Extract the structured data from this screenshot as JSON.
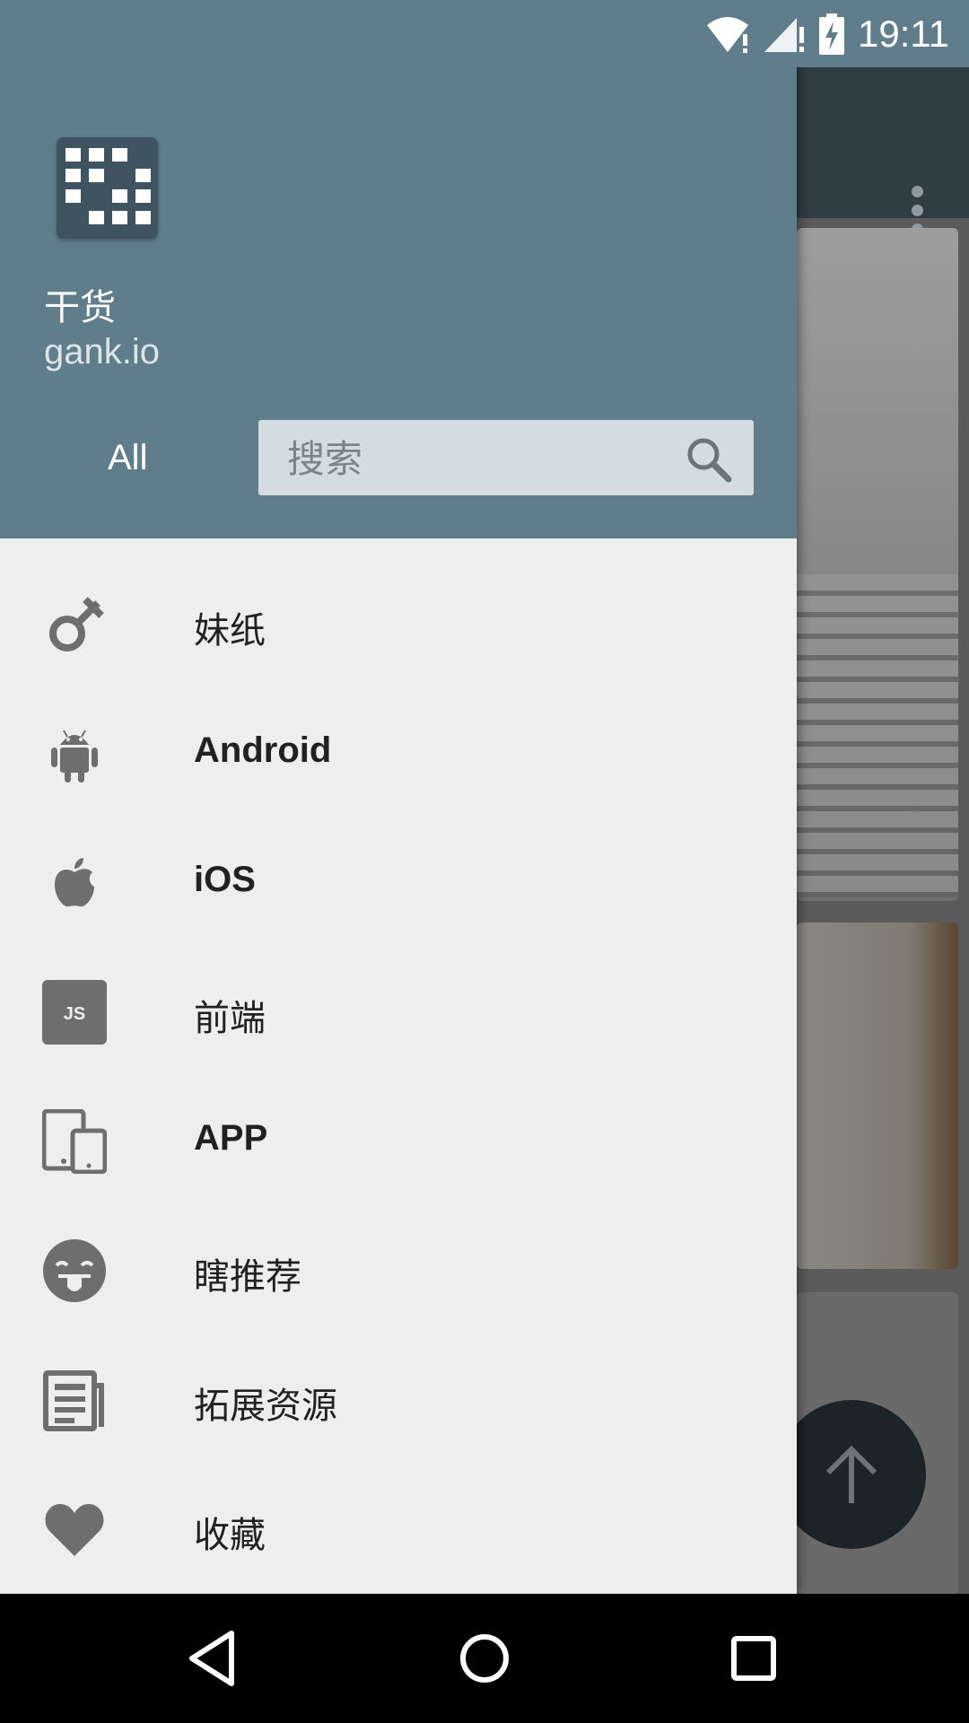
{
  "status_bar": {
    "time": "19:11",
    "icons": [
      "wifi-alert-icon",
      "signal-alert-icon",
      "battery-charging-icon"
    ]
  },
  "drawer": {
    "header": {
      "app_title": "干货",
      "app_subtitle": "gank.io",
      "filter_value": "All",
      "search_placeholder": "搜索"
    },
    "items": [
      {
        "label": "妹纸",
        "icon": "female-gender-icon"
      },
      {
        "label": "Android",
        "icon": "android-icon"
      },
      {
        "label": "iOS",
        "icon": "apple-icon"
      },
      {
        "label": "前端",
        "icon": "javascript-icon"
      },
      {
        "label": "APP",
        "icon": "devices-icon"
      },
      {
        "label": "瞎推荐",
        "icon": "tongue-emoji-icon"
      },
      {
        "label": "拓展资源",
        "icon": "newspaper-icon"
      },
      {
        "label": "收藏",
        "icon": "heart-icon"
      }
    ]
  },
  "colors": {
    "header": "#607d8b",
    "drawer_bg": "#eeeeee",
    "icon": "#6e6e6e",
    "text": "#212121"
  },
  "nav_bar": {
    "buttons": [
      "back-icon",
      "home-icon",
      "recents-icon"
    ]
  }
}
